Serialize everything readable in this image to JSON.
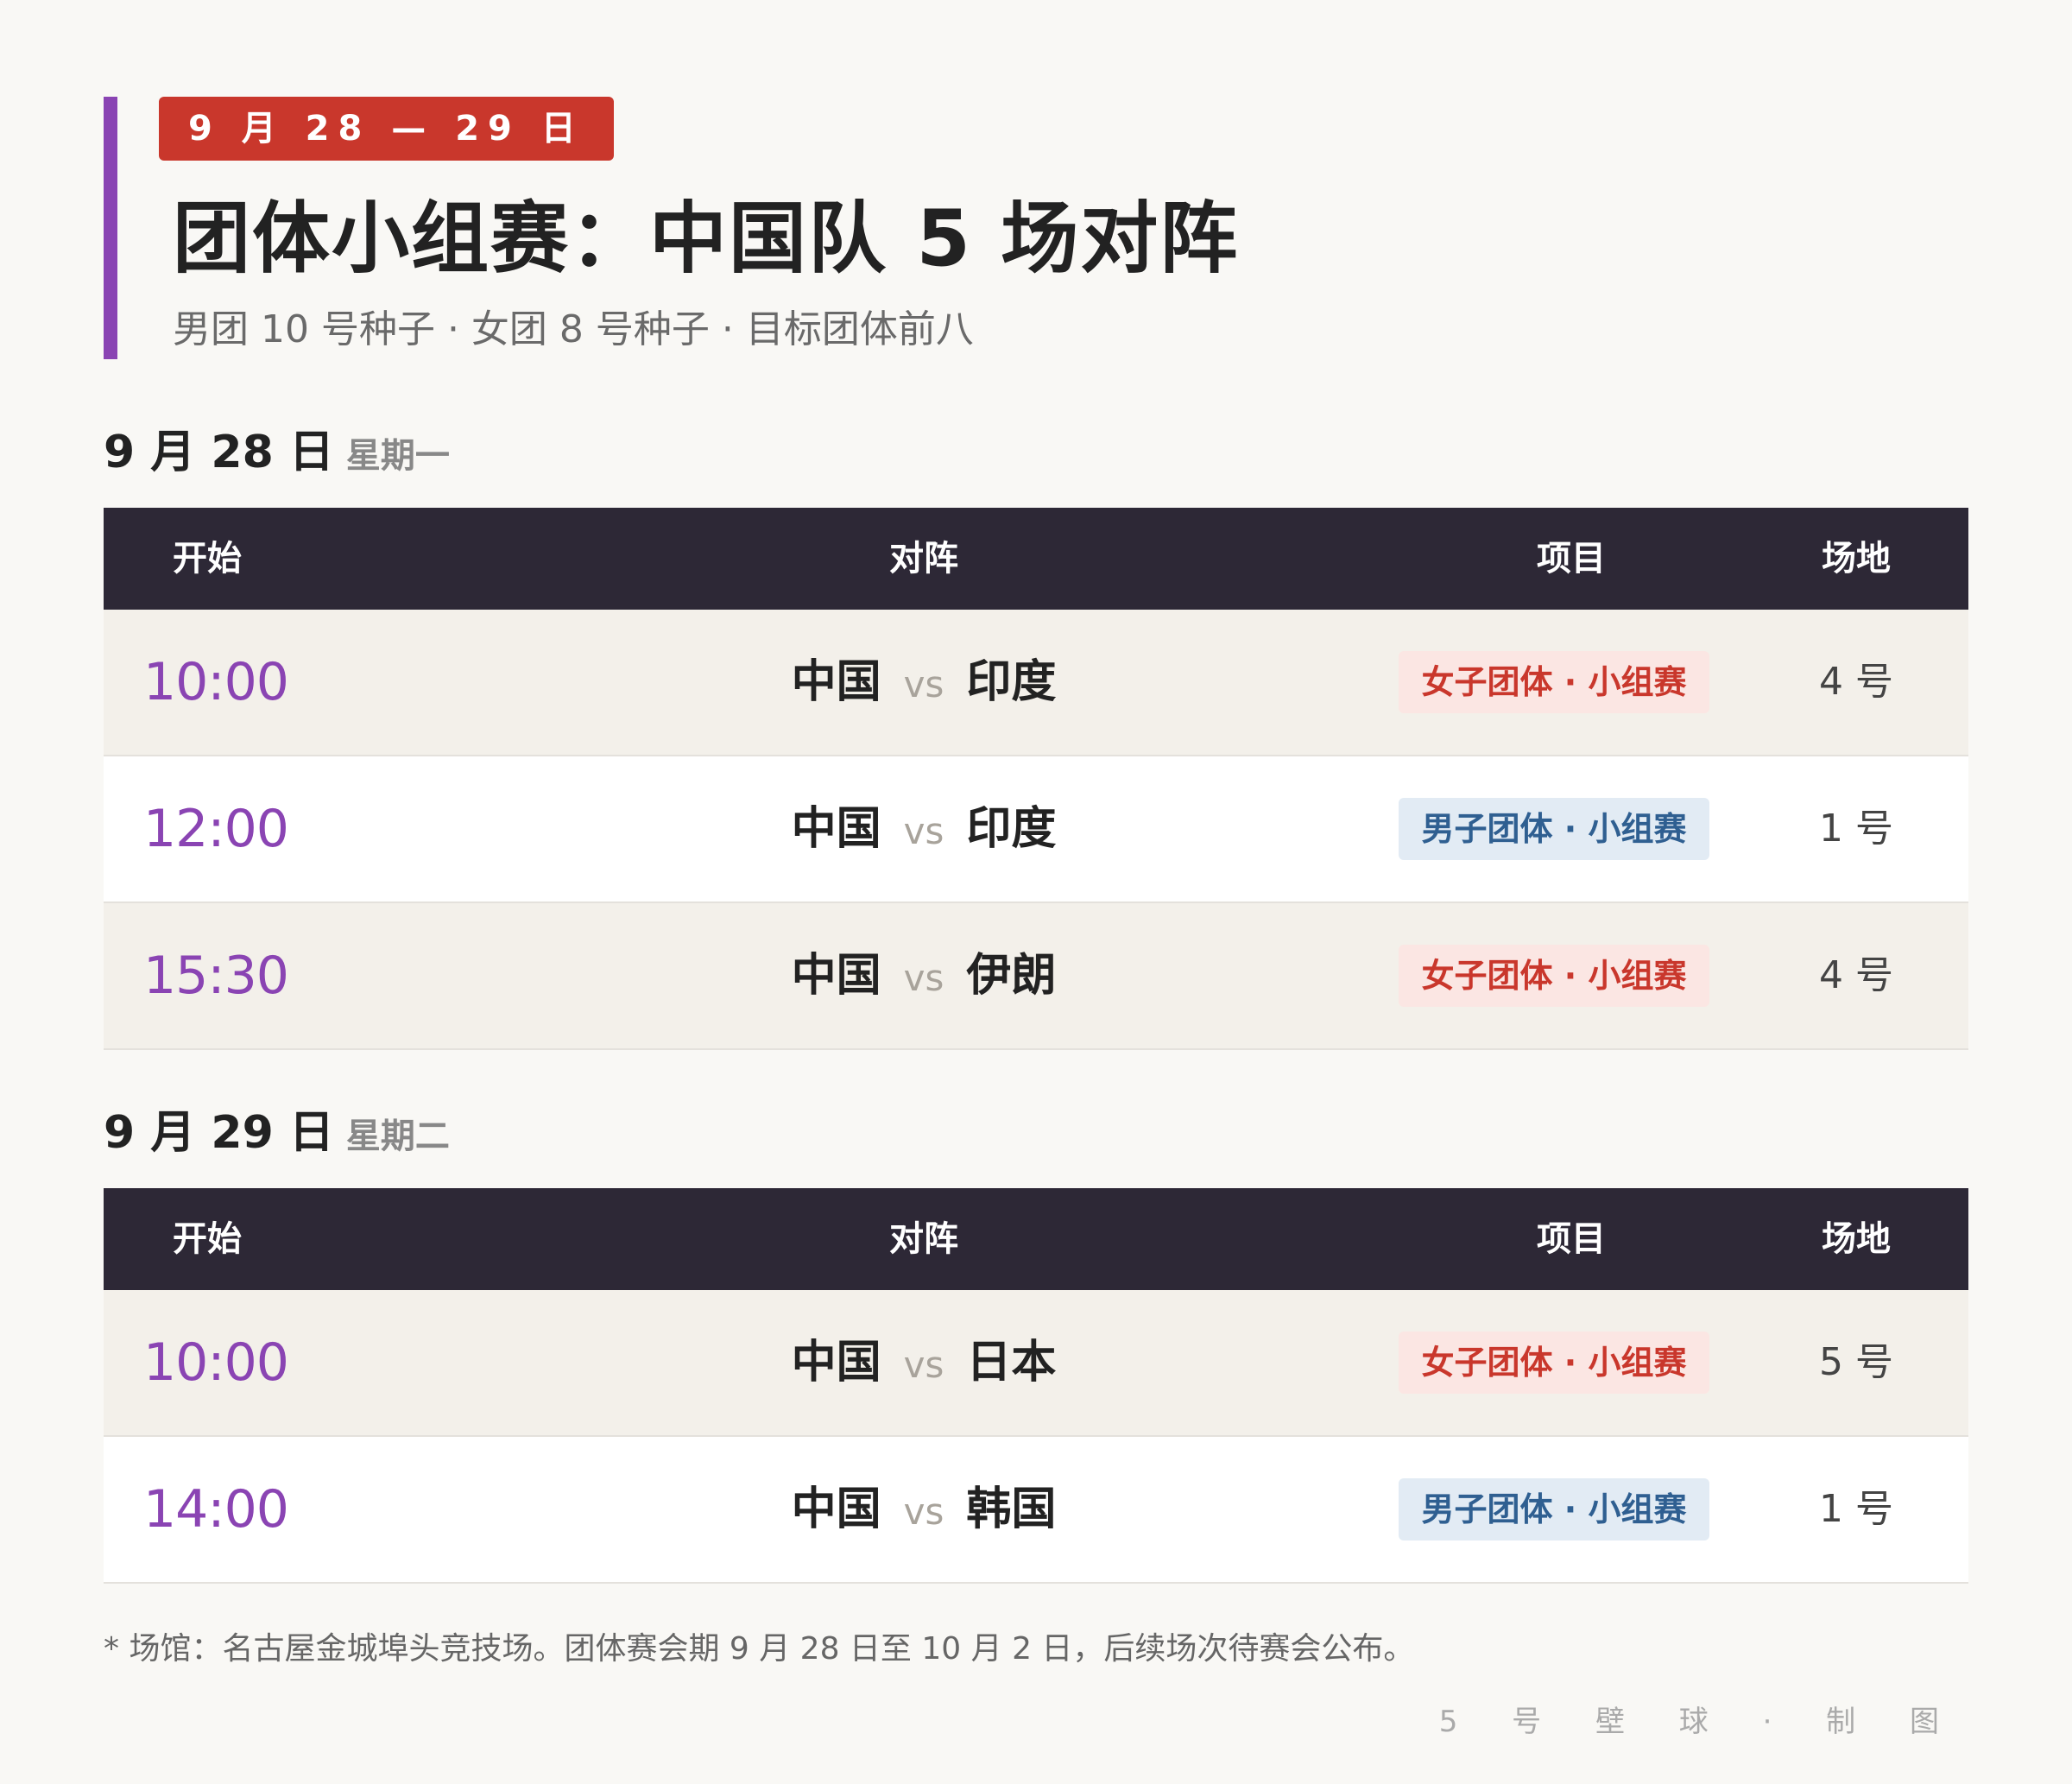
{
  "header": {
    "date_badge": "9 月 28 — 29 日",
    "title": "团体小组赛：中国队 5 场对阵",
    "subtitle": "男团 10 号种子 · 女团 8 号种子 · 目标团体前八"
  },
  "table_headers": {
    "time": "开始",
    "match": "对阵",
    "event": "项目",
    "venue": "场地"
  },
  "days": [
    {
      "date": "9 月 28 日",
      "weekday": "星期一",
      "rows": [
        {
          "time": "10:00",
          "home": "中国",
          "vs": "vs",
          "away": "印度",
          "event": "女子团体 · 小组赛",
          "event_type": "women",
          "venue": "4 号"
        },
        {
          "time": "12:00",
          "home": "中国",
          "vs": "vs",
          "away": "印度",
          "event": "男子团体 · 小组赛",
          "event_type": "men",
          "venue": "1 号"
        },
        {
          "time": "15:30",
          "home": "中国",
          "vs": "vs",
          "away": "伊朗",
          "event": "女子团体 · 小组赛",
          "event_type": "women",
          "venue": "4 号"
        }
      ]
    },
    {
      "date": "9 月 29 日",
      "weekday": "星期二",
      "rows": [
        {
          "time": "10:00",
          "home": "中国",
          "vs": "vs",
          "away": "日本",
          "event": "女子团体 · 小组赛",
          "event_type": "women",
          "venue": "5 号"
        },
        {
          "time": "14:00",
          "home": "中国",
          "vs": "vs",
          "away": "韩国",
          "event": "男子团体 · 小组赛",
          "event_type": "men",
          "venue": "1 号"
        }
      ]
    }
  ],
  "footnote": "* 场馆：名古屋金城埠头竞技场。团体赛会期 9 月 28 日至 10 月 2 日，后续场次待赛会公布。",
  "credit": "5 号 壁 球 · 制 图",
  "colors": {
    "accent_purple": "#8a44b3",
    "badge_red": "#c9372c",
    "table_header_bg": "#2d2836",
    "women_tag_bg": "#fbe6e3",
    "women_tag_text": "#c9372c",
    "men_tag_bg": "#e2ebf4",
    "men_tag_text": "#2f5f91"
  }
}
